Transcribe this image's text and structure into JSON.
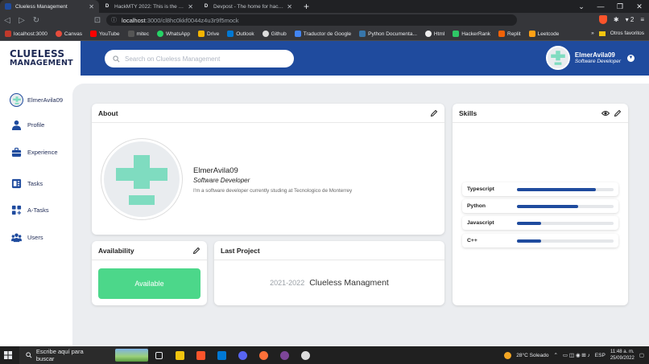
{
  "browser": {
    "tabs": [
      {
        "title": "Clueless Management",
        "active": true
      },
      {
        "title": "HackMTY 2022: This is the largest stu",
        "active": false
      },
      {
        "title": "Devpost - The home for hackathons",
        "active": false
      }
    ],
    "url_host": "localhost",
    "url_path": ":3000/cl8hc0kkf0044z4u3r9f5mock",
    "shield_count": "2",
    "bookmarks": [
      "localhost:3000",
      "Canvas",
      "YouTube",
      "mitec",
      "WhatsApp",
      "Drive",
      "Outlook",
      "Github",
      "Traductor de Google",
      "Python Documenta...",
      "Html",
      "HackerRank",
      "Replit",
      "Leetcode"
    ],
    "bookmarks_more": "»",
    "other_favorites": "Otros favoritos"
  },
  "app": {
    "logo_line1": "CLUELESS",
    "logo_line2": "MANAGEMENT",
    "search_placeholder": "Search on Clueless Management",
    "user": {
      "name": "ElmerAvila09",
      "role": "Software Developer"
    },
    "sidebar": {
      "username": "ElmerAvila09",
      "items": [
        {
          "label": "Profile",
          "icon": "person-icon"
        },
        {
          "label": "Experience",
          "icon": "briefcase-icon"
        },
        {
          "label": "Tasks",
          "icon": "tasks-icon"
        },
        {
          "label": "A-Tasks",
          "icon": "grid-plus-icon"
        },
        {
          "label": "Users",
          "icon": "users-icon"
        }
      ]
    },
    "about": {
      "title": "About",
      "name": "ElmerAvila09",
      "role": "Software Developer",
      "description": "I'm a software developer currently studing at Tecnologico de Monterrey"
    },
    "skills": {
      "title": "Skills",
      "items": [
        {
          "name": "Typescript",
          "level": 0.82
        },
        {
          "name": "Python",
          "level": 0.63
        },
        {
          "name": "Javascript",
          "level": 0.25
        },
        {
          "name": "C++",
          "level": 0.25
        }
      ]
    },
    "availability": {
      "title": "Availability",
      "button": "Available"
    },
    "last_project": {
      "title": "Last Project",
      "years": "2021-2022",
      "name": "Clueless Managment"
    },
    "colors": {
      "primary": "#1f4b9e",
      "available": "#4cd78a",
      "avatar": "#7fdcc0"
    }
  },
  "taskbar": {
    "search_placeholder": "Escribe aquí para buscar",
    "weather": "28°C  Soleado",
    "lang": "ESP",
    "time": "11:48 a. m.",
    "date": "25/09/2022"
  }
}
